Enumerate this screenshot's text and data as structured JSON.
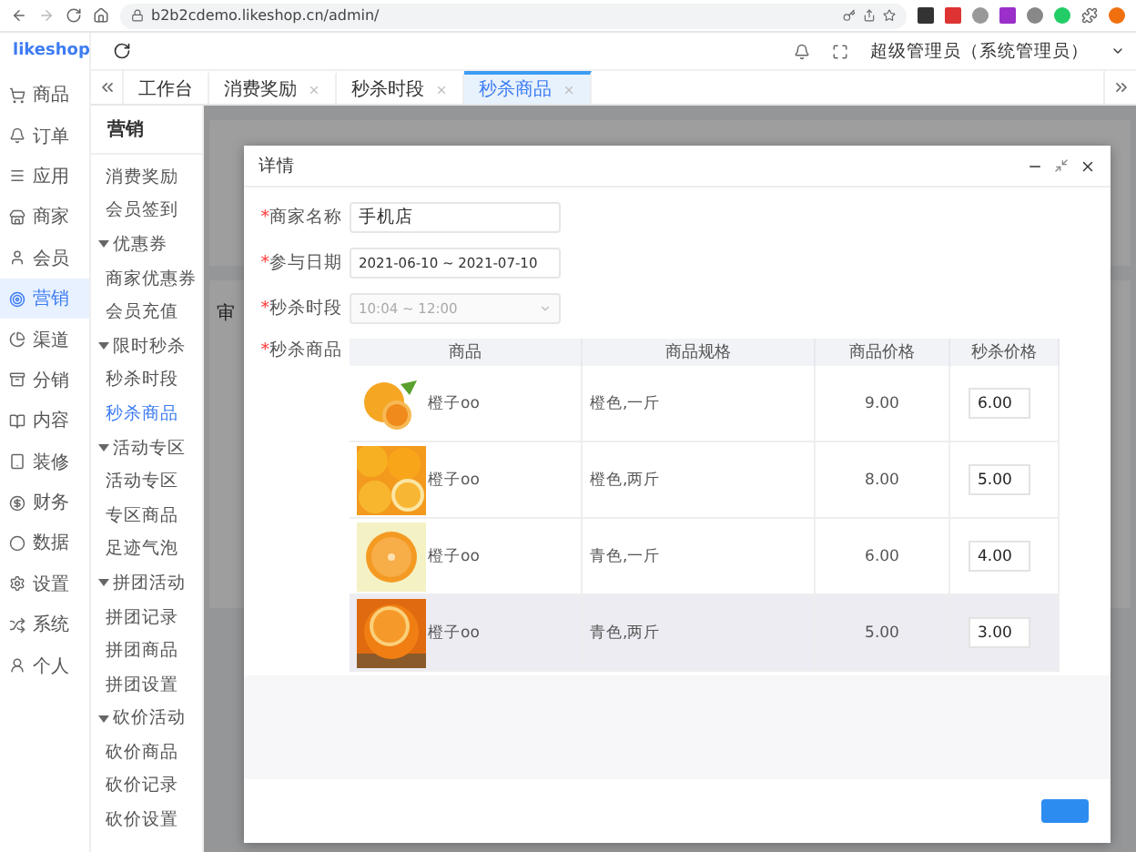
{
  "browser": {
    "url": "b2b2cdemo.likeshop.cn/admin/"
  },
  "logo": "likeshop",
  "header": {
    "user": "超级管理员（系统管理员）"
  },
  "tabs": [
    {
      "label": "工作台",
      "closable": false,
      "selected": false
    },
    {
      "label": "消费奖励",
      "closable": true,
      "selected": false
    },
    {
      "label": "秒杀时段",
      "closable": true,
      "selected": false
    },
    {
      "label": "秒杀商品",
      "closable": true,
      "selected": true
    }
  ],
  "main_nav": [
    {
      "label": "商品",
      "selected": false
    },
    {
      "label": "订单",
      "selected": false
    },
    {
      "label": "应用",
      "selected": false
    },
    {
      "label": "商家",
      "selected": false
    },
    {
      "label": "会员",
      "selected": false
    },
    {
      "label": "营销",
      "selected": true
    },
    {
      "label": "渠道",
      "selected": false
    },
    {
      "label": "分销",
      "selected": false
    },
    {
      "label": "内容",
      "selected": false
    },
    {
      "label": "装修",
      "selected": false
    },
    {
      "label": "财务",
      "selected": false
    },
    {
      "label": "数据",
      "selected": false
    },
    {
      "label": "设置",
      "selected": false
    },
    {
      "label": "系统",
      "selected": false
    },
    {
      "label": "个人",
      "selected": false
    }
  ],
  "sub_nav": {
    "title": "营销",
    "items": [
      {
        "kind": "item",
        "label": "消费奖励",
        "selected": false
      },
      {
        "kind": "item",
        "label": "会员签到",
        "selected": false
      },
      {
        "kind": "group",
        "label": "优惠券",
        "expanded": true,
        "children": [
          {
            "label": "商家优惠券",
            "selected": false
          },
          {
            "label": "会员充值",
            "selected": false
          }
        ]
      },
      {
        "kind": "group",
        "label": "限时秒杀",
        "expanded": true,
        "children": [
          {
            "label": "秒杀时段",
            "selected": false
          },
          {
            "label": "秒杀商品",
            "selected": true
          }
        ]
      },
      {
        "kind": "group",
        "label": "活动专区",
        "expanded": true,
        "children": [
          {
            "label": "活动专区",
            "selected": false
          },
          {
            "label": "专区商品",
            "selected": false
          },
          {
            "label": "足迹气泡",
            "selected": false
          }
        ]
      },
      {
        "kind": "group",
        "label": "拼团活动",
        "expanded": true,
        "children": [
          {
            "label": "拼团记录",
            "selected": false
          },
          {
            "label": "拼团商品",
            "selected": false
          },
          {
            "label": "拼团设置",
            "selected": false
          }
        ]
      },
      {
        "kind": "group",
        "label": "砍价活动",
        "expanded": true,
        "children": [
          {
            "label": "砍价商品",
            "selected": false
          },
          {
            "label": "砍价记录",
            "selected": false
          },
          {
            "label": "砍价设置",
            "selected": false
          }
        ]
      }
    ]
  },
  "background": {
    "section": "审"
  },
  "required_mark": "*",
  "dialog": {
    "title": "详情",
    "fields": [
      {
        "kind": "input",
        "label": "商家名称",
        "required": true,
        "disabled": false,
        "value": "手机店"
      },
      {
        "kind": "input",
        "label": "参与日期",
        "required": true,
        "disabled": false,
        "value": "2021-06-10 ~ 2021-07-10"
      },
      {
        "kind": "select",
        "label": "秒杀时段",
        "required": true,
        "disabled": true,
        "value": "10:04 ~ 12:00"
      }
    ],
    "goods": {
      "label": "秒杀商品",
      "required": true,
      "columns": [
        "商品",
        "商品规格",
        "商品价格",
        "秒杀价格"
      ],
      "rows": [
        {
          "name": "橙子oo",
          "spec": "橙色,一斤",
          "price": "9.00",
          "seckill_price": "6.00",
          "hovered": false
        },
        {
          "name": "橙子oo",
          "spec": "橙色,两斤",
          "price": "8.00",
          "seckill_price": "5.00",
          "hovered": false
        },
        {
          "name": "橙子oo",
          "spec": "青色,一斤",
          "price": "6.00",
          "seckill_price": "4.00",
          "hovered": false
        },
        {
          "name": "橙子oo",
          "spec": "青色,两斤",
          "price": "5.00",
          "seckill_price": "3.00",
          "hovered": true
        }
      ]
    }
  }
}
